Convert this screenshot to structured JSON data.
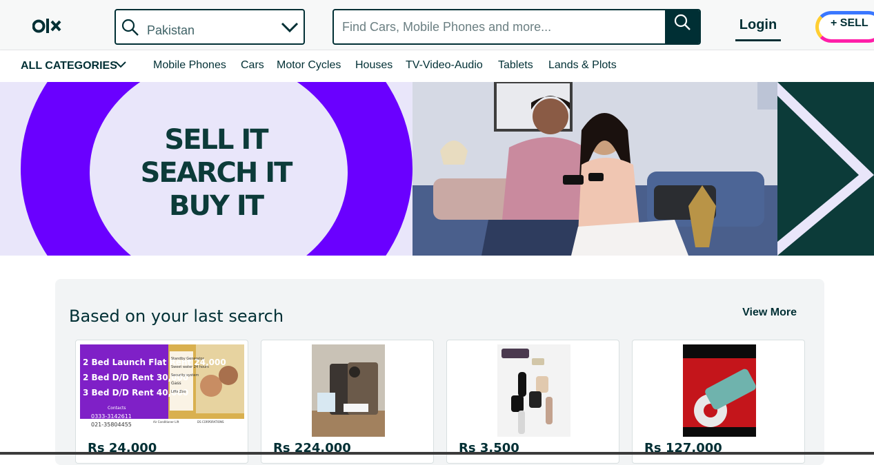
{
  "header": {
    "location": {
      "value": "Pakistan"
    },
    "search": {
      "placeholder": "Find Cars, Mobile Phones and more..."
    },
    "login_label": "Login",
    "sell_label": "+ SELL"
  },
  "categories": {
    "all_label": "ALL CATEGORIES",
    "items": [
      "Mobile Phones",
      "Cars",
      "Motor Cycles",
      "Houses",
      "TV-Video-Audio",
      "Tablets",
      "Lands & Plots"
    ]
  },
  "banner": {
    "slogan_lines": [
      "SELL IT",
      "SEARCH IT",
      "BUY IT"
    ]
  },
  "section": {
    "title": "Based on your last search",
    "view_more": "View More",
    "listings": [
      {
        "price": "Rs 24,000",
        "image_text": [
          "2 Bed Launch Flat Rent 24,000",
          "2 Bed D/D Rent 30,000",
          "3 Bed D/D Rent 40,000",
          "Standby Generator",
          "Sweet water 24 hours",
          "Security system",
          "Gass",
          "Lifts Zoo",
          "Contacts",
          "0333-3142611",
          "021-35804455",
          "Air Conditioner Lift",
          "DS CORPORATIONS"
        ]
      },
      {
        "price": "Rs 224,000"
      },
      {
        "price": "Rs 3,500"
      },
      {
        "price": "Rs 127,000"
      }
    ]
  },
  "colors": {
    "brand_dark": "#002f34",
    "banner_purple": "#6a00ff",
    "banner_bg": "#e9e6fa",
    "banner_teal": "#0c3b39"
  }
}
